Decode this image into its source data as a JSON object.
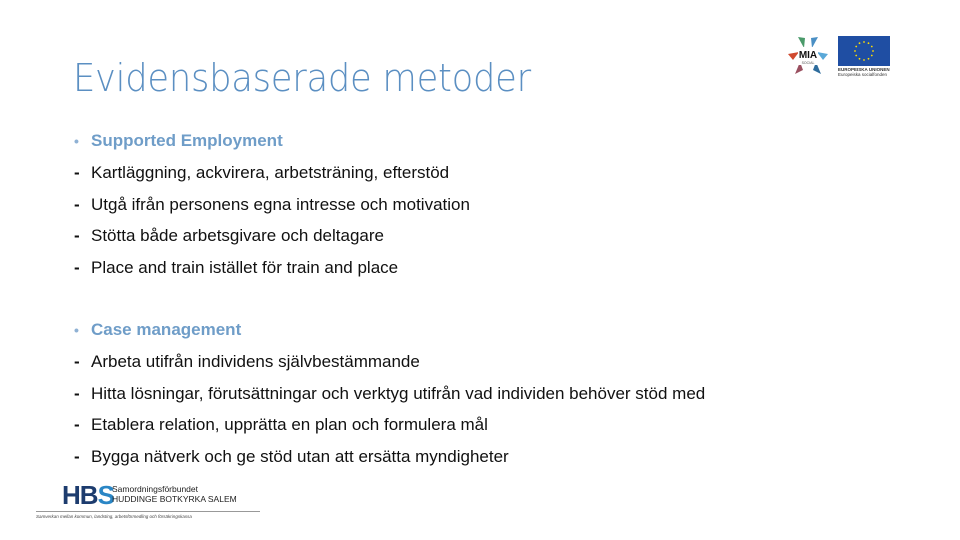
{
  "slide": {
    "title": "Evidensbaserade metoder",
    "sections": [
      {
        "heading": "Supported Employment",
        "heading_marker": "•",
        "items": [
          {
            "marker": "-",
            "text": "Kartläggning, ackvirera, arbetsträning, efterstöd"
          },
          {
            "marker": "-",
            "text": "Utgå ifrån personens egna intresse och motivation"
          },
          {
            "marker": "-",
            "text": "Stötta både arbetsgivare och deltagare"
          },
          {
            "marker": "-",
            "text": "Place and train istället för train and place"
          }
        ]
      },
      {
        "heading": "Case management",
        "heading_marker": "•",
        "items": [
          {
            "marker": "-",
            "text": "Arbeta utifrån individens självbestämmande"
          },
          {
            "marker": "-",
            "text": "Hitta lösningar, förutsättningar och verktyg utifrån vad individen behöver stöd med"
          },
          {
            "marker": "-",
            "text": "Etablera relation, upprätta en plan och formulera mål"
          },
          {
            "marker": "-",
            "text": "Bygga nätverk och ge stöd utan att ersätta myndigheter"
          }
        ]
      }
    ]
  },
  "logos": {
    "mia": {
      "label": "MIA",
      "sublabel": "SOCIAL"
    },
    "eu": {
      "line1": "EUROPEISKA UNIONEN",
      "line2": "Europeiska socialfonden"
    },
    "hbs": {
      "mark_hb": "HB",
      "mark_s": "S",
      "name_line1": "Samordningsförbundet",
      "name_line2": "HUDDINGE BOTKYRKA SALEM",
      "tagline": "Samverkan mellan kommun, landsting, arbetsförmedling och försäkringskassa"
    }
  },
  "colors": {
    "title": "#5b8fc2",
    "heading": "#6f9dc8",
    "eu_blue": "#1f4ea3",
    "eu_star": "#ffdd00",
    "hbs_dark": "#1d3c6e",
    "hbs_light": "#2a86c5"
  }
}
